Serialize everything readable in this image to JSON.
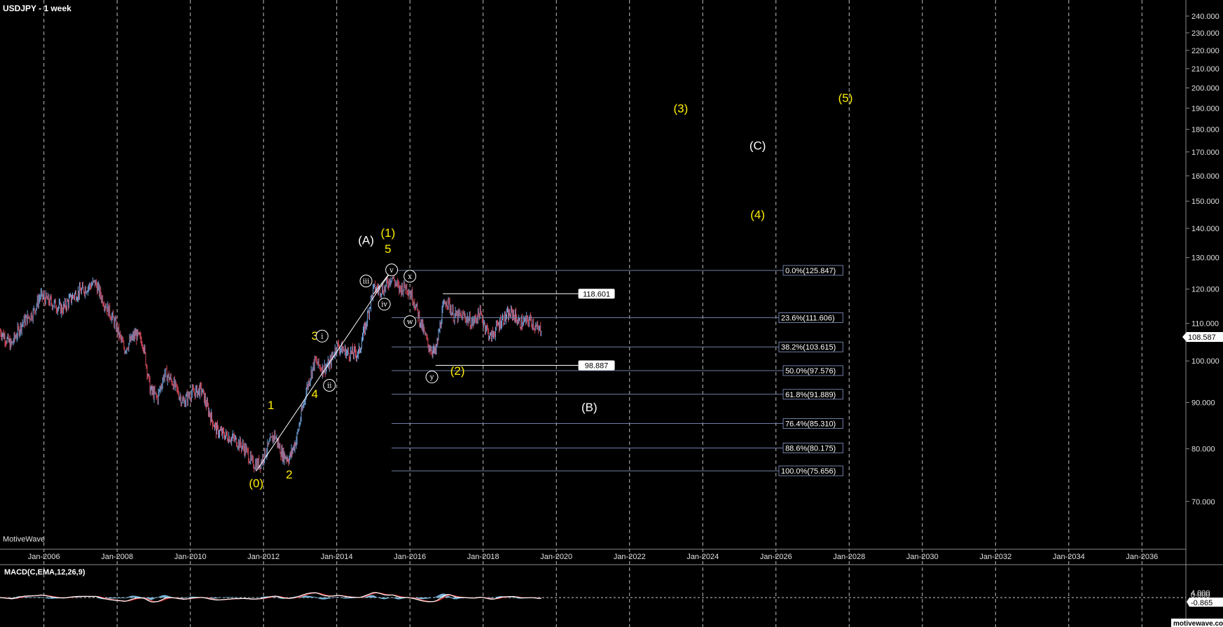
{
  "chart_title": "USDJPY - 1 week",
  "watermark": "MotiveWave",
  "footer": "motivewave.com",
  "colors": {
    "background": "#000000",
    "yellow": "#ffee00",
    "white": "#ffffff",
    "fib": "#6f7fa5",
    "candle_up": "#6f9fd6",
    "candle_down": "#d0475a",
    "macd_line": "#ffffff",
    "signal_line": "#e03030",
    "hist": "#7ab6da"
  },
  "chart_data": {
    "type": "candlestick",
    "symbol": "USDJPY",
    "timeframe": "1 week",
    "x_tick_labels": [
      "Jan-2006",
      "Jan-2008",
      "Jan-2010",
      "Jan-2012",
      "Jan-2014",
      "Jan-2016",
      "Jan-2018",
      "Jan-2020",
      "Jan-2022",
      "Jan-2024",
      "Jan-2026",
      "Jan-2028",
      "Jan-2030",
      "Jan-2032",
      "Jan-2034",
      "Jan-2036"
    ],
    "x_range": [
      2004.8,
      2037.2
    ],
    "y_scale": "log",
    "y_range": [
      62,
      250
    ],
    "y_tick_labels": [
      70,
      80,
      90,
      100,
      110,
      120,
      130,
      140,
      150,
      160,
      170,
      180,
      190,
      200,
      210,
      220,
      230,
      240
    ],
    "y_tick_display": [
      "70.000",
      "80.000",
      "90.000",
      "100.000",
      "110.000",
      "120.000",
      "130.000",
      "140.000",
      "150.000",
      "160.000",
      "170.000",
      "180.000",
      "190.000",
      "200.000",
      "210.000",
      "220.000",
      "230.000",
      "240.000"
    ],
    "last_price": "108.587",
    "price_path": [
      [
        2004.8,
        108
      ],
      [
        2005.1,
        104
      ],
      [
        2005.4,
        110
      ],
      [
        2005.7,
        113
      ],
      [
        2005.9,
        118
      ],
      [
        2006.2,
        116
      ],
      [
        2006.5,
        114
      ],
      [
        2006.8,
        118
      ],
      [
        2007.1,
        120
      ],
      [
        2007.4,
        122
      ],
      [
        2007.6,
        117
      ],
      [
        2007.9,
        111
      ],
      [
        2008.2,
        103
      ],
      [
        2008.5,
        107
      ],
      [
        2008.7,
        105
      ],
      [
        2008.9,
        93
      ],
      [
        2009.1,
        91
      ],
      [
        2009.3,
        97
      ],
      [
        2009.5,
        95
      ],
      [
        2009.8,
        90
      ],
      [
        2010.0,
        92
      ],
      [
        2010.3,
        93
      ],
      [
        2010.5,
        88
      ],
      [
        2010.7,
        84
      ],
      [
        2010.9,
        83
      ],
      [
        2011.2,
        82
      ],
      [
        2011.5,
        80
      ],
      [
        2011.7,
        77
      ],
      [
        2011.9,
        77
      ],
      [
        2012.1,
        80
      ],
      [
        2012.3,
        83
      ],
      [
        2012.5,
        79
      ],
      [
        2012.7,
        78
      ],
      [
        2012.9,
        82
      ],
      [
        2013.2,
        94
      ],
      [
        2013.4,
        100
      ],
      [
        2013.6,
        98
      ],
      [
        2013.8,
        99
      ],
      [
        2014.0,
        104
      ],
      [
        2014.3,
        102
      ],
      [
        2014.6,
        102
      ],
      [
        2014.8,
        110
      ],
      [
        2015.0,
        120
      ],
      [
        2015.3,
        120
      ],
      [
        2015.5,
        124
      ],
      [
        2015.7,
        120
      ],
      [
        2015.9,
        121
      ],
      [
        2016.1,
        117
      ],
      [
        2016.3,
        110
      ],
      [
        2016.5,
        104
      ],
      [
        2016.7,
        102
      ],
      [
        2016.9,
        114
      ],
      [
        2017.0,
        117
      ],
      [
        2017.2,
        112
      ],
      [
        2017.5,
        112
      ],
      [
        2017.7,
        110
      ],
      [
        2017.9,
        113
      ],
      [
        2018.2,
        106
      ],
      [
        2018.5,
        111
      ],
      [
        2018.8,
        113
      ],
      [
        2019.0,
        110
      ],
      [
        2019.3,
        111
      ],
      [
        2019.5,
        108
      ],
      [
        2019.6,
        108.6
      ]
    ],
    "trend_lines": [
      {
        "from": [
          2011.8,
          75.6
        ],
        "to": [
          2015.5,
          125.8
        ]
      },
      {
        "from": [
          2015.0,
          118.5
        ],
        "to": [
          2015.5,
          125.8
        ]
      }
    ],
    "fib_levels": [
      {
        "label": "0.0%(125.847)",
        "value": 125.847
      },
      {
        "label": "23.6%(111.606)",
        "value": 111.606
      },
      {
        "label": "38.2%(103.615)",
        "value": 103.615
      },
      {
        "label": "50.0%(97.576)",
        "value": 97.576
      },
      {
        "label": "61.8%(91.889)",
        "value": 91.889
      },
      {
        "label": "76.4%(85.310)",
        "value": 85.31
      },
      {
        "label": "88.6%(80.175)",
        "value": 80.175
      },
      {
        "label": "100.0%(75.656)",
        "value": 75.656
      }
    ],
    "price_markers": [
      {
        "label": "118.601",
        "value": 118.601
      },
      {
        "label": "98.887",
        "value": 98.887
      }
    ],
    "wave_labels": [
      {
        "text": "(0)",
        "x": 2011.8,
        "y": 72.6,
        "color": "yellow"
      },
      {
        "text": "1",
        "x": 2012.2,
        "y": 88.5,
        "color": "yellow"
      },
      {
        "text": "2",
        "x": 2012.7,
        "y": 74.2,
        "color": "yellow"
      },
      {
        "text": "3",
        "x": 2013.4,
        "y": 105.5,
        "color": "yellow"
      },
      {
        "text": "4",
        "x": 2013.4,
        "y": 91.0,
        "color": "yellow"
      },
      {
        "text": "5",
        "x": 2015.4,
        "y": 131.5,
        "color": "yellow"
      },
      {
        "text": "(1)",
        "x": 2015.4,
        "y": 137.0,
        "color": "yellow"
      },
      {
        "text": "(A)",
        "x": 2014.8,
        "y": 134.5,
        "color": "white"
      },
      {
        "text": "(2)",
        "x": 2017.3,
        "y": 96.5,
        "color": "yellow"
      },
      {
        "text": "(B)",
        "x": 2020.9,
        "y": 88.0,
        "color": "white"
      },
      {
        "text": "(3)",
        "x": 2023.4,
        "y": 188.0,
        "color": "yellow"
      },
      {
        "text": "(C)",
        "x": 2025.5,
        "y": 171.0,
        "color": "white"
      },
      {
        "text": "(4)",
        "x": 2025.5,
        "y": 143.5,
        "color": "yellow"
      },
      {
        "text": "(5)",
        "x": 2027.9,
        "y": 193.0,
        "color": "yellow"
      }
    ],
    "circle_labels": [
      {
        "text": "i",
        "x": 2013.6,
        "y": 106.5
      },
      {
        "text": "ii",
        "x": 2013.8,
        "y": 94.0
      },
      {
        "text": "iii",
        "x": 2014.8,
        "y": 122.5
      },
      {
        "text": "iv",
        "x": 2015.3,
        "y": 115.5
      },
      {
        "text": "v",
        "x": 2015.5,
        "y": 126.0
      },
      {
        "text": "x",
        "x": 2016.0,
        "y": 124.0
      },
      {
        "text": "w",
        "x": 2016.0,
        "y": 110.5
      },
      {
        "text": "y",
        "x": 2016.6,
        "y": 96.0
      }
    ],
    "indicator": {
      "label": "MACD(C,EMA,12,26,9)",
      "y_tick_display": [
        "4.000",
        "0.000"
      ],
      "last_value": "-0.865"
    }
  }
}
